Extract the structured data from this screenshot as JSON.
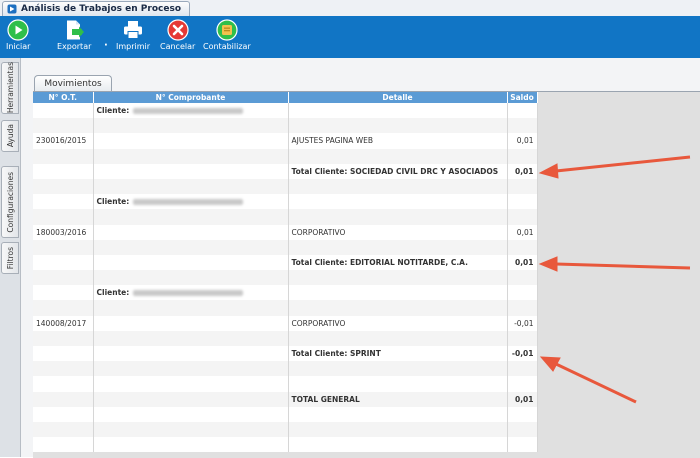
{
  "window": {
    "title": "Análisis de Trabajos en Proceso",
    "icon": "app-window-icon"
  },
  "toolbar": {
    "buttons": [
      {
        "label": "Iniciar",
        "icon": "play-circle-icon",
        "color": "#2fbf4a"
      },
      {
        "label": "Exportar",
        "icon": "export-document-icon",
        "color": "#ffffff"
      },
      {
        "label": "Imprimir",
        "icon": "printer-icon",
        "color": "#ffffff"
      },
      {
        "label": "Cancelar",
        "icon": "cancel-x-icon",
        "color": "#e53935"
      },
      {
        "label": "Contabilizar",
        "icon": "ledger-icon",
        "color": "#f2c14e"
      }
    ]
  },
  "sidebar": {
    "tabs": [
      "Herramientas",
      "Ayuda",
      "Configuraciones",
      "Filtros"
    ]
  },
  "tab": {
    "label": "Movimientos"
  },
  "grid": {
    "columns": [
      "N° O.T.",
      "N° Comprobante",
      "Detalle",
      "Saldo"
    ],
    "rows": [
      {
        "ot": "",
        "comprobante": "Cliente:",
        "comp_redacted": true,
        "detalle": "",
        "saldo": "",
        "style": "client"
      },
      {
        "ot": "",
        "comprobante": "",
        "detalle": "",
        "saldo": ""
      },
      {
        "ot": "230016/2015",
        "comprobante": "",
        "detalle": "AJUSTES PAGINA WEB",
        "saldo": "0,01"
      },
      {
        "ot": "",
        "comprobante": "",
        "detalle": "",
        "saldo": ""
      },
      {
        "ot": "",
        "comprobante": "",
        "detalle": "Total Cliente: SOCIEDAD CIVIL DRC Y ASOCIADOS",
        "saldo": "0,01",
        "style": "total"
      },
      {
        "ot": "",
        "comprobante": "",
        "detalle": "",
        "saldo": ""
      },
      {
        "ot": "",
        "comprobante": "Cliente:",
        "comp_redacted": true,
        "detalle": "",
        "saldo": "",
        "style": "client"
      },
      {
        "ot": "",
        "comprobante": "",
        "detalle": "",
        "saldo": ""
      },
      {
        "ot": "180003/2016",
        "comprobante": "",
        "detalle": "CORPORATIVO",
        "saldo": "0,01"
      },
      {
        "ot": "",
        "comprobante": "",
        "detalle": "",
        "saldo": ""
      },
      {
        "ot": "",
        "comprobante": "",
        "detalle": "Total Cliente: EDITORIAL NOTITARDE, C.A.",
        "saldo": "0,01",
        "style": "total"
      },
      {
        "ot": "",
        "comprobante": "",
        "detalle": "",
        "saldo": ""
      },
      {
        "ot": "",
        "comprobante": "Cliente:",
        "comp_redacted": true,
        "detalle": "",
        "saldo": "",
        "style": "client"
      },
      {
        "ot": "",
        "comprobante": "",
        "detalle": "",
        "saldo": ""
      },
      {
        "ot": "140008/2017",
        "comprobante": "",
        "detalle": "CORPORATIVO",
        "saldo": "-0,01",
        "negative": true
      },
      {
        "ot": "",
        "comprobante": "",
        "detalle": "",
        "saldo": ""
      },
      {
        "ot": "",
        "comprobante": "",
        "detalle": "Total Cliente: SPRINT",
        "saldo": "-0,01",
        "style": "total"
      },
      {
        "ot": "",
        "comprobante": "",
        "detalle": "",
        "saldo": ""
      },
      {
        "ot": "",
        "comprobante": "",
        "detalle": "",
        "saldo": ""
      },
      {
        "ot": "",
        "comprobante": "",
        "detalle": "TOTAL GENERAL",
        "saldo": "0,01",
        "style": "total"
      },
      {
        "ot": "",
        "comprobante": "",
        "detalle": "",
        "saldo": ""
      },
      {
        "ot": "",
        "comprobante": "",
        "detalle": "",
        "saldo": ""
      },
      {
        "ot": "",
        "comprobante": "",
        "detalle": "",
        "saldo": ""
      }
    ]
  },
  "colors": {
    "toolbar": "#1175c5",
    "grid_header": "#5b9bd5",
    "annotation_arrow": "#e8583c",
    "negative_value": "#2140d4"
  }
}
